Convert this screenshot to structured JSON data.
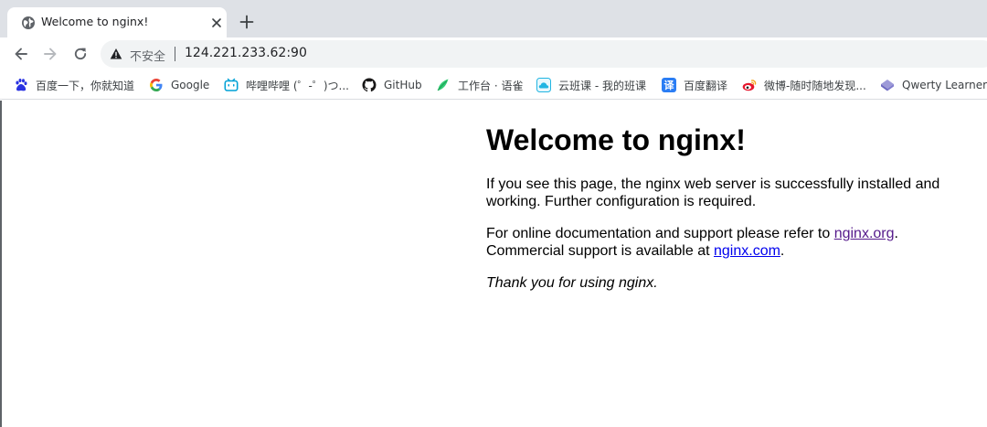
{
  "browser": {
    "tab": {
      "title": "Welcome to nginx!"
    },
    "address_bar": {
      "security_label": "不安全",
      "url": "124.221.233.62:90"
    },
    "bookmarks": [
      {
        "label": "百度一下，你就知道",
        "icon": "baidu-paw-icon"
      },
      {
        "label": "Google",
        "icon": "google-icon"
      },
      {
        "label": "哔哩哔哩 (゜-゜)つ...",
        "icon": "bilibili-icon"
      },
      {
        "label": "GitHub",
        "icon": "github-icon"
      },
      {
        "label": "工作台 · 语雀",
        "icon": "yuque-icon"
      },
      {
        "label": "云班课 - 我的班课",
        "icon": "cloud-class-icon"
      },
      {
        "label": "百度翻译",
        "icon": "baidu-translate-icon"
      },
      {
        "label": "微博-随时随地发现...",
        "icon": "weibo-icon"
      },
      {
        "label": "Qwerty Learner",
        "icon": "qwerty-icon"
      }
    ]
  },
  "page": {
    "heading": "Welcome to nginx!",
    "para1": "If you see this page, the nginx web server is successfully installed and working. Further configuration is required.",
    "para2_prefix": "For online documentation and support please refer to ",
    "link_org": "nginx.org",
    "para2_mid": ".",
    "para2_line2_prefix": "Commercial support is available at ",
    "link_com": "nginx.com",
    "para2_suffix": ".",
    "thanks": "Thank you for using nginx."
  },
  "colors": {
    "tabstrip_bg": "#dee1e6",
    "omnibox_bg": "#f1f3f4",
    "link": "#0000ee",
    "visited_link": "#551a8b"
  }
}
